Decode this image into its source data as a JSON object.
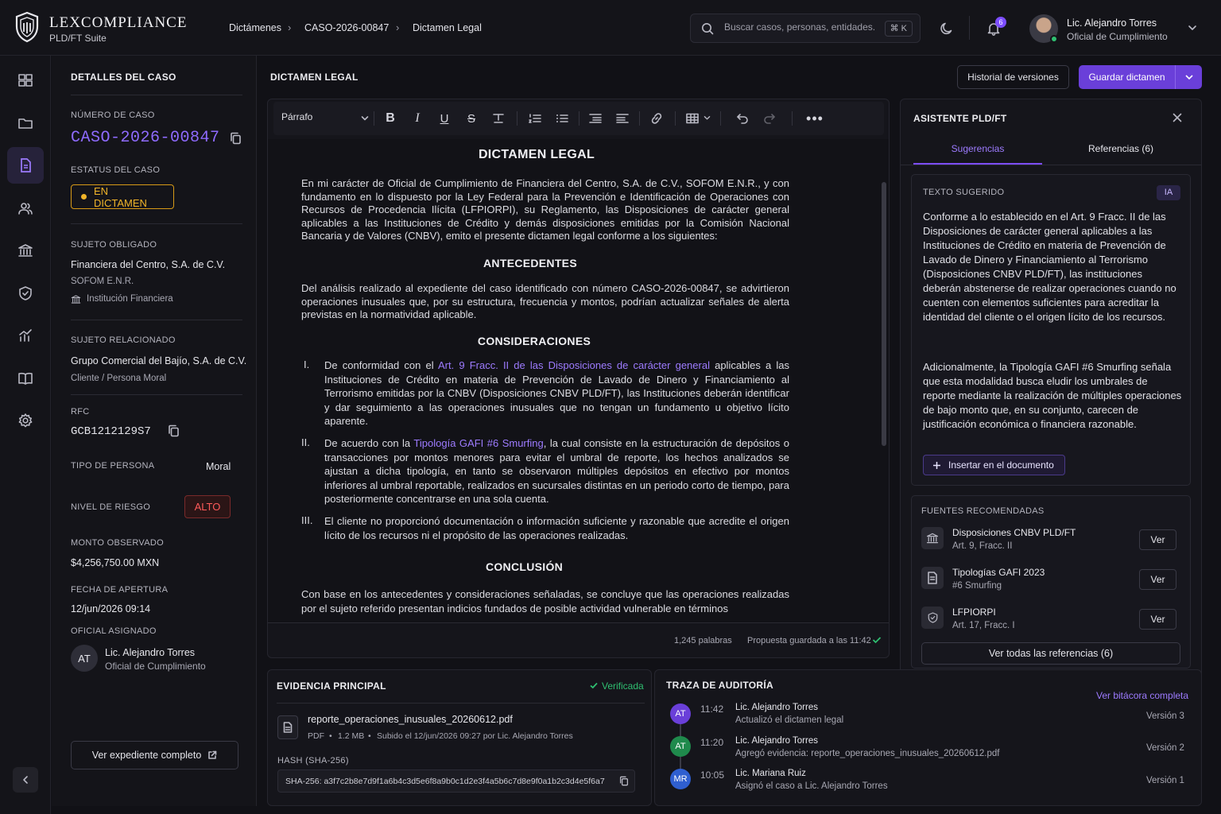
{
  "brand": {
    "title": "LEXCOMPLIANCE",
    "subtitle": "PLD/FT Suite"
  },
  "breadcrumb": [
    "Dictámenes",
    "CASO-2026-00847",
    "Dictamen Legal"
  ],
  "search": {
    "placeholder": "Buscar casos, personas, entidades...",
    "shortcut": "⌘ K"
  },
  "notifications": {
    "count": "6"
  },
  "user": {
    "name": "Lic. Alejandro Torres",
    "role": "Oficial de Cumplimiento"
  },
  "details": {
    "title": "DETALLES DEL CASO",
    "case_number_label": "NÚMERO DE CASO",
    "case_number": "CASO-2026-00847",
    "status_label": "ESTATUS DEL CASO",
    "status": "EN DICTAMEN",
    "obligated_label": "SUJETO OBLIGADO",
    "obligated_name": "Financiera del Centro, S.A. de C.V.",
    "obligated_type": "SOFOM E.N.R.",
    "obligated_kind": "Institución Financiera",
    "related_label": "SUJETO RELACIONADO",
    "related_name": "Grupo Comercial del Bajío, S.A. de C.V.",
    "related_kind": "Cliente / Persona Moral",
    "rfc_label": "RFC",
    "rfc": "GCB1212129S7",
    "person_type_label": "TIPO DE PERSONA",
    "person_type": "Moral",
    "risk_label": "NIVEL DE RIESGO",
    "risk": "ALTO",
    "amount_label": "MONTO OBSERVADO",
    "amount": "$4,256,750.00 MXN",
    "opened_label": "FECHA DE APERTURA",
    "opened": "12/jun/2026 09:14",
    "officer_label": "OFICIAL ASIGNADO",
    "officer_initials": "AT",
    "officer_name": "Lic. Alejandro Torres",
    "officer_role": "Oficial de Cumplimiento",
    "full_file_button": "Ver expediente completo"
  },
  "center": {
    "title": "DICTAMEN LEGAL",
    "history_button": "Historial de versiones",
    "save_button": "Guardar dictamen"
  },
  "toolbar": {
    "paragraph_style": "Párrafo"
  },
  "document": {
    "title": "DICTAMEN LEGAL",
    "intro": "En mi carácter de Oficial de Cumplimiento de Financiera del Centro, S.A. de C.V., SOFOM E.N.R., y con fundamento en lo dispuesto por la Ley Federal para la Prevención e Identificación de Operaciones con Recursos de Procedencia Ilícita (LFPIORPI), su Reglamento, las Disposiciones de carácter general aplicables a las Instituciones de Crédito y demás disposiciones emitidas por la Comisión Nacional Bancaria y de Valores (CNBV), emito el presente dictamen legal conforme a los siguientes:",
    "h_antecedentes": "ANTECEDENTES",
    "antecedentes": "Del análisis realizado al expediente del caso identificado con número CASO-2026-00847, se advirtieron operaciones inusuales que, por su estructura, frecuencia y montos, podrían actualizar señales de alerta previstas en la normatividad aplicable.",
    "h_consideraciones": "CONSIDERACIONES",
    "c1_num": "I.",
    "c1_pre": "De conformidad con el ",
    "c1_link": "Art. 9 Fracc. II de las Disposiciones de carácter general",
    "c1_post": " aplicables a las Instituciones de Crédito en materia de Prevención de Lavado de Dinero y Financiamiento al Terrorismo emitidas por la CNBV (Disposiciones CNBV PLD/FT), las Instituciones deberán identificar y dar seguimiento a las operaciones inusuales que no tengan un fundamento u objetivo lícito aparente.",
    "c2_num": "II.",
    "c2_pre": "De acuerdo con la ",
    "c2_link": "Tipología GAFI #6 Smurfing",
    "c2_post": ", la cual consiste en la estructuración de depósitos o transacciones por montos menores para evitar el umbral de reporte, los hechos analizados se ajustan a dicha tipología, en tanto se observaron múltiples depósitos en efectivo por montos inferiores al umbral reportable, realizados en sucursales distintas en un periodo corto de tiempo, para posteriormente concentrarse en una sola cuenta.",
    "c3_num": "III.",
    "c3_text": "El cliente no proporcionó documentación o información suficiente y razonable que acredite el origen lícito de los recursos ni el propósito de las operaciones realizadas.",
    "h_conclusion": "CONCLUSIÓN",
    "conclusion": "Con base en los antecedentes y consideraciones señaladas, se concluye que las operaciones realizadas por el sujeto referido presentan indicios fundados de posible actividad vulnerable en términos"
  },
  "editor_footer": {
    "words": "1,245 palabras",
    "saved": "Propuesta guardada a las 11:42"
  },
  "assistant": {
    "title": "ASISTENTE PLD/FT",
    "tab_suggestions": "Sugerencias",
    "tab_references": "Referencias (6)",
    "suggested_label": "TEXTO SUGERIDO",
    "ai_badge": "IA",
    "suggestion_p1": "Conforme a lo establecido en el Art. 9 Fracc. II de las Disposiciones de carácter general aplicables a las Instituciones de Crédito en materia de Prevención de Lavado de Dinero y Financiamiento al Terrorismo (Disposiciones CNBV PLD/FT), las instituciones deberán abstenerse de realizar operaciones cuando no cuenten con elementos suficientes para acreditar la identidad del cliente o el origen lícito de los recursos.",
    "suggestion_p2": "Adicionalmente, la Tipología GAFI #6 Smurfing señala que esta modalidad busca eludir los umbrales de reporte mediante la realización de múltiples operaciones de bajo monto que, en su conjunto, carecen de justificación económica o financiera razonable.",
    "insert_button": "Insertar en el documento",
    "sources_label": "FUENTES RECOMENDADAS",
    "sources": [
      {
        "title": "Disposiciones CNBV PLD/FT",
        "sub": "Art. 9, Fracc. II",
        "action": "Ver"
      },
      {
        "title": "Tipologías GAFI 2023",
        "sub": "#6 Smurfing",
        "action": "Ver"
      },
      {
        "title": "LFPIORPI",
        "sub": "Art. 17, Fracc. I",
        "action": "Ver"
      }
    ],
    "all_refs_button": "Ver todas las referencias (6)"
  },
  "evidence": {
    "title": "EVIDENCIA PRINCIPAL",
    "verified": "Verificada",
    "file_name": "reporte_operaciones_inusuales_20260612.pdf",
    "file_type": "PDF",
    "file_size": "1.2 MB",
    "file_uploaded": "Subido el 12/jun/2026 09:27 por Lic. Alejandro Torres",
    "hash_label": "HASH (SHA-256)",
    "hash": "SHA-256: a3f7c2b8e7d9f1a6b4c3d5e6f8a9b0c1d2e3f4a5b6c7d8e9f0a1b2c3d4e5f6a7"
  },
  "audit": {
    "title": "TRAZA DE AUDITORÍA",
    "full_log_link": "Ver bitácora completa",
    "entries": [
      {
        "initials": "AT",
        "time": "11:42",
        "user": "Lic. Alejandro Torres",
        "action": "Actualizó el dictamen legal",
        "version": "Versión 3",
        "color": "#6a3fd9"
      },
      {
        "initials": "AT",
        "time": "11:20",
        "user": "Lic. Alejandro Torres",
        "action": "Agregó evidencia: reporte_operaciones_inusuales_20260612.pdf",
        "version": "Versión 2",
        "color": "#1f8a4c"
      },
      {
        "initials": "MR",
        "time": "10:05",
        "user": "Lic. Mariana Ruiz",
        "action": "Asignó el caso a Lic. Alejandro Torres",
        "version": "Versión 1",
        "color": "#2f5fd0"
      }
    ]
  },
  "colors": {
    "accent": "#7c4dff",
    "status": "#f0b429",
    "risk": "#ff5a5a",
    "verified": "#2fbf71"
  }
}
